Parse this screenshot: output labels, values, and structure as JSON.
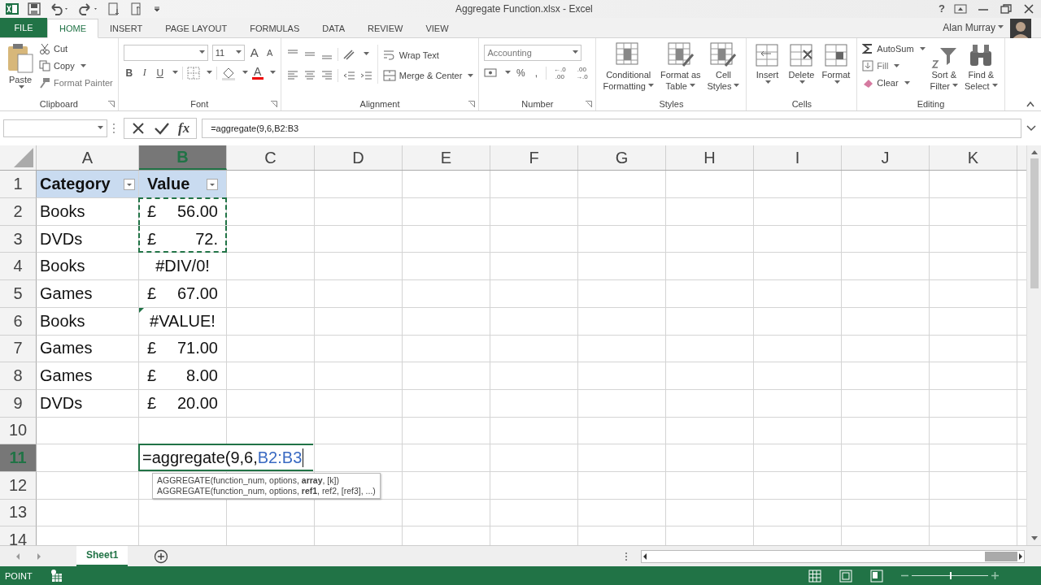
{
  "title_bar": {
    "title": "Aggregate Function.xlsx - Excel",
    "help": "?"
  },
  "ribbon_tabs": [
    {
      "label": "FILE",
      "kind": "file",
      "selected": false
    },
    {
      "label": "HOME",
      "kind": "tab",
      "selected": true
    },
    {
      "label": "INSERT",
      "kind": "tab",
      "selected": false
    },
    {
      "label": "PAGE LAYOUT",
      "kind": "tab",
      "selected": false
    },
    {
      "label": "FORMULAS",
      "kind": "tab",
      "selected": false
    },
    {
      "label": "DATA",
      "kind": "tab",
      "selected": false
    },
    {
      "label": "REVIEW",
      "kind": "tab",
      "selected": false
    },
    {
      "label": "VIEW",
      "kind": "tab",
      "selected": false
    }
  ],
  "user": {
    "name": "Alan Murray"
  },
  "clipboard": {
    "label": "Clipboard",
    "paste": "Paste",
    "cut": "Cut",
    "copy": "Copy",
    "format_painter": "Format Painter"
  },
  "font": {
    "label": "Font",
    "size": "11",
    "grow": "A",
    "shrink": "A",
    "bold": "B",
    "italic": "I",
    "underline": "U",
    "font_color_button": "A"
  },
  "alignment": {
    "label": "Alignment",
    "wrap": "Wrap Text",
    "merge": "Merge & Center"
  },
  "number": {
    "label": "Number",
    "format": "Accounting",
    "percent": "%",
    "comma": ",",
    "increase_decimal": "←.0 .00",
    "decrease_decimal": ".00 →.0"
  },
  "styles": {
    "label": "Styles",
    "buttons": [
      [
        "Conditional",
        "Formatting"
      ],
      [
        "Format as",
        "Table"
      ],
      [
        "Cell",
        "Styles"
      ]
    ]
  },
  "cells": {
    "label": "Cells",
    "buttons": [
      "Insert",
      "Delete",
      "Format"
    ]
  },
  "editing": {
    "label": "Editing",
    "autosum": "AutoSum",
    "fill": "Fill",
    "clear": "Clear",
    "sort": [
      "Sort &",
      "Filter"
    ],
    "find": [
      "Find &",
      "Select"
    ]
  },
  "formula_bar": {
    "function_label": "fx",
    "formula": "=aggregate(9,6,B2:B3"
  },
  "columns": [
    {
      "letter": "A",
      "selected": false
    },
    {
      "letter": "B",
      "selected": true
    },
    {
      "letter": "C",
      "selected": false
    },
    {
      "letter": "D",
      "selected": false
    },
    {
      "letter": "E",
      "selected": false
    },
    {
      "letter": "F",
      "selected": false
    },
    {
      "letter": "G",
      "selected": false
    },
    {
      "letter": "H",
      "selected": false
    },
    {
      "letter": "I",
      "selected": false
    },
    {
      "letter": "J",
      "selected": false
    },
    {
      "letter": "K",
      "selected": false
    }
  ],
  "rows": [
    {
      "number": "1",
      "selected": false,
      "category": "Category",
      "value": {
        "kind": "header",
        "text": "Value",
        "marquee": false,
        "flagged": false
      }
    },
    {
      "number": "2",
      "selected": false,
      "category": "Books",
      "value": {
        "kind": "currency",
        "symbol": "£",
        "amount": "56.00",
        "marquee": true,
        "flagged": false
      }
    },
    {
      "number": "3",
      "selected": false,
      "category": "DVDs",
      "value": {
        "kind": "currency",
        "symbol": "£",
        "amount": "72.",
        "marquee": true,
        "flagged": false
      }
    },
    {
      "number": "4",
      "selected": false,
      "category": "Books",
      "value": {
        "kind": "error",
        "text": "#DIV/0!",
        "marquee": false,
        "flagged": false
      }
    },
    {
      "number": "5",
      "selected": false,
      "category": "Games",
      "value": {
        "kind": "currency",
        "symbol": "£",
        "amount": "67.00",
        "marquee": false,
        "flagged": false
      }
    },
    {
      "number": "6",
      "selected": false,
      "category": "Books",
      "value": {
        "kind": "error",
        "text": "#VALUE!",
        "marquee": false,
        "flagged": true
      }
    },
    {
      "number": "7",
      "selected": false,
      "category": "Games",
      "value": {
        "kind": "currency",
        "symbol": "£",
        "amount": "71.00",
        "marquee": false,
        "flagged": false
      }
    },
    {
      "number": "8",
      "selected": false,
      "category": "Games",
      "value": {
        "kind": "currency",
        "symbol": "£",
        "amount": "8.00",
        "marquee": false,
        "flagged": false
      }
    },
    {
      "number": "9",
      "selected": false,
      "category": "DVDs",
      "value": {
        "kind": "currency",
        "symbol": "£",
        "amount": "20.00",
        "marquee": false,
        "flagged": false
      }
    },
    {
      "number": "10",
      "selected": false
    },
    {
      "number": "11",
      "selected": true,
      "editing": {
        "text": "=aggregate(9,6,",
        "reference": "B2:B3"
      }
    },
    {
      "number": "12",
      "selected": false
    },
    {
      "number": "13",
      "selected": false
    },
    {
      "number": "14",
      "selected": false
    }
  ],
  "tooltip": [
    "AGGREGATE(function_num, options, **array**, [k])",
    "AGGREGATE(function_num, options, **ref1**, ref2, [ref3], ...)"
  ],
  "sheet_tabs": [
    {
      "label": "Sheet1",
      "selected": true
    }
  ],
  "status_bar": {
    "mode": "POINT"
  },
  "zoom_slider": {
    "level": 0.5
  }
}
